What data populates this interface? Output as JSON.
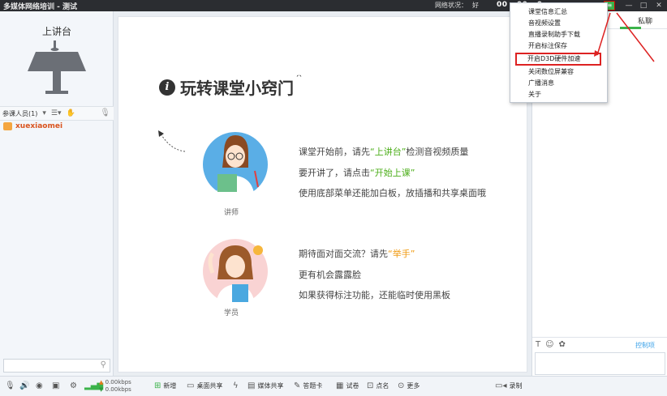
{
  "window": {
    "title": "多媒体网络培训 - 测试",
    "network_label": "网络状况：",
    "network_value": "好",
    "timer": "00 : 00 : 0"
  },
  "left_panel": {
    "podium_label": "上讲台",
    "participants_label": "参课人员(1)",
    "user_name": "xuexiaomei",
    "search_placeholder": ""
  },
  "main": {
    "tips_title": "玩转课堂小窍门",
    "teacher_role": "讲师",
    "student_role": "学员",
    "teacher_line1_pre": "课堂开始前，请先",
    "teacher_line1_hl": "“上讲台”",
    "teacher_line1_post": "检测音视频质量",
    "teacher_line2_pre": "要开讲了，请点击",
    "teacher_line2_hl": "“开始上课”",
    "teacher_line3": "使用底部菜单还能加白板，放插播和共享桌面哦",
    "student_line1_pre": "期待面对面交流？请先",
    "student_line1_hl": "“举手”",
    "student_line2": "更有机会露露脸",
    "student_line3": "如果获得标注功能，还能临时使用黑板"
  },
  "context_menu": {
    "items": [
      "课堂信息汇总",
      "音视频设置",
      "直播录制助手下载",
      "开启标注保存",
      "开启D3D硬件加速",
      "关闭数位屏兼容",
      "广播消息",
      "关于"
    ],
    "highlighted_index": 4
  },
  "right_panel": {
    "chat_tab": "私聊",
    "control_label": "控制项"
  },
  "bottom_bar": {
    "upload_speed": "0.00kbps",
    "download_speed": "0.00kbps",
    "items": [
      "新增",
      "桌面共享",
      "媒体共享",
      "答题卡",
      "试卷",
      "点名",
      "更多"
    ],
    "record_label": "录制"
  },
  "colors": {
    "accent_green": "#4cae1a",
    "accent_orange": "#f09a10",
    "highlight_red": "#dd2222"
  }
}
